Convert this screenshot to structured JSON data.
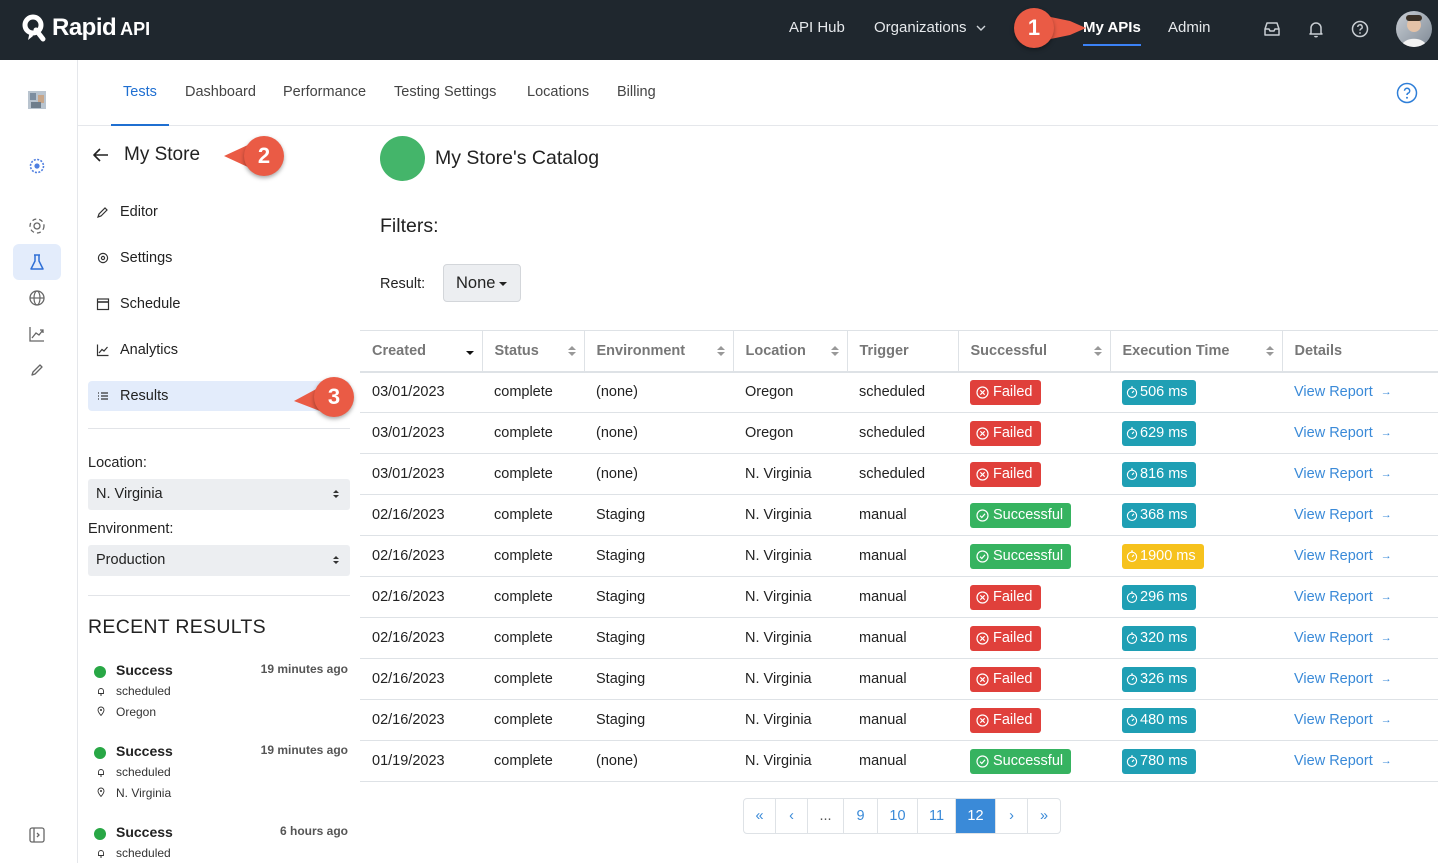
{
  "topnav": {
    "logo_text": "Rapid",
    "logo_sub": "API",
    "links": [
      "API Hub",
      "Organizations",
      "My APIs",
      "Admin"
    ],
    "active_link": "My APIs",
    "accent_color": "#3b82f6"
  },
  "callouts": [
    "1",
    "2",
    "3"
  ],
  "subtabs": [
    "Tests",
    "Dashboard",
    "Performance",
    "Testing Settings",
    "Locations",
    "Billing"
  ],
  "active_subtab": "Tests",
  "panel": {
    "back_title": "My Store",
    "menu": [
      "Editor",
      "Settings",
      "Schedule",
      "Analytics",
      "Results"
    ],
    "active_menu": "Results",
    "location_label": "Location:",
    "location_value": "N. Virginia",
    "environment_label": "Environment:",
    "environment_value": "Production",
    "recent_title": "RECENT RESULTS",
    "recent": [
      {
        "status": "Success",
        "ago": "19 minutes ago",
        "trigger": "scheduled",
        "location": "Oregon"
      },
      {
        "status": "Success",
        "ago": "19 minutes ago",
        "trigger": "scheduled",
        "location": "N. Virginia"
      },
      {
        "status": "Success",
        "ago": "6 hours ago",
        "trigger": "scheduled",
        "location": ""
      }
    ]
  },
  "main": {
    "title": "My Store's Catalog",
    "status_color": "#44b56a",
    "filters_title": "Filters:",
    "result_label": "Result:",
    "result_value": "None"
  },
  "table": {
    "headers": [
      "Created",
      "Status",
      "Environment",
      "Location",
      "Trigger",
      "Successful",
      "Execution Time",
      "Details"
    ],
    "link_label": "View Report",
    "rows": [
      {
        "created": "03/01/2023",
        "status": "complete",
        "env": "(none)",
        "loc": "Oregon",
        "trigger": "scheduled",
        "ok": "Failed",
        "time": "506 ms",
        "slow": false
      },
      {
        "created": "03/01/2023",
        "status": "complete",
        "env": "(none)",
        "loc": "Oregon",
        "trigger": "scheduled",
        "ok": "Failed",
        "time": "629 ms",
        "slow": false
      },
      {
        "created": "03/01/2023",
        "status": "complete",
        "env": "(none)",
        "loc": "N. Virginia",
        "trigger": "scheduled",
        "ok": "Failed",
        "time": "816 ms",
        "slow": false
      },
      {
        "created": "02/16/2023",
        "status": "complete",
        "env": "Staging",
        "loc": "N. Virginia",
        "trigger": "manual",
        "ok": "Successful",
        "time": "368 ms",
        "slow": false
      },
      {
        "created": "02/16/2023",
        "status": "complete",
        "env": "Staging",
        "loc": "N. Virginia",
        "trigger": "manual",
        "ok": "Successful",
        "time": "1900 ms",
        "slow": true
      },
      {
        "created": "02/16/2023",
        "status": "complete",
        "env": "Staging",
        "loc": "N. Virginia",
        "trigger": "manual",
        "ok": "Failed",
        "time": "296 ms",
        "slow": false
      },
      {
        "created": "02/16/2023",
        "status": "complete",
        "env": "Staging",
        "loc": "N. Virginia",
        "trigger": "manual",
        "ok": "Failed",
        "time": "320 ms",
        "slow": false
      },
      {
        "created": "02/16/2023",
        "status": "complete",
        "env": "Staging",
        "loc": "N. Virginia",
        "trigger": "manual",
        "ok": "Failed",
        "time": "326 ms",
        "slow": false
      },
      {
        "created": "02/16/2023",
        "status": "complete",
        "env": "Staging",
        "loc": "N. Virginia",
        "trigger": "manual",
        "ok": "Failed",
        "time": "480 ms",
        "slow": false
      },
      {
        "created": "01/19/2023",
        "status": "complete",
        "env": "(none)",
        "loc": "N. Virginia",
        "trigger": "manual",
        "ok": "Successful",
        "time": "780 ms",
        "slow": false
      }
    ]
  },
  "pagination": {
    "first": "«",
    "prev": "‹",
    "ellipsis": "...",
    "pages": [
      "9",
      "10",
      "11",
      "12"
    ],
    "current": "12",
    "next": "›",
    "last": "»"
  },
  "colors": {
    "failed": "#e0403b",
    "success": "#36b360",
    "time": "#1f9fb4",
    "time_slow": "#f6c21d",
    "link": "#3a8ad8"
  }
}
